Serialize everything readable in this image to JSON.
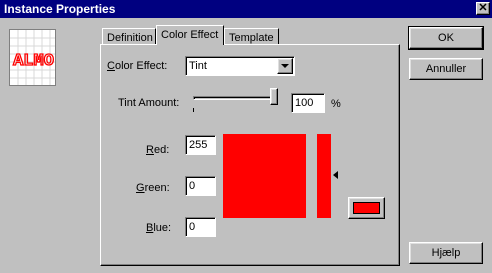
{
  "window": {
    "title": "Instance Properties",
    "close_glyph": "✕"
  },
  "preview": {
    "logo_text": "ALMO",
    "logo_color": "#ff0000"
  },
  "tabs": [
    {
      "label": "Definition"
    },
    {
      "label": "Color Effect"
    },
    {
      "label": "Template"
    }
  ],
  "color_effect": {
    "label": "Color Effect:",
    "label_mnemonic": "C",
    "label_rest": "olor Effect:",
    "value": "Tint"
  },
  "tint": {
    "label": "Tint Amount:",
    "value": "100",
    "unit": "%",
    "slider_level_percent": 100
  },
  "red": {
    "label_mnemonic": "R",
    "label_rest": "ed:",
    "value": "255"
  },
  "green": {
    "label_mnemonic": "G",
    "label_rest": "reen:",
    "value": "0"
  },
  "blue": {
    "label_mnemonic": "B",
    "label_rest": "lue:",
    "value": "0"
  },
  "current_color": "#ff0000",
  "buttons": {
    "ok": "OK",
    "cancel": "Annuller",
    "help": "Hjælp"
  }
}
